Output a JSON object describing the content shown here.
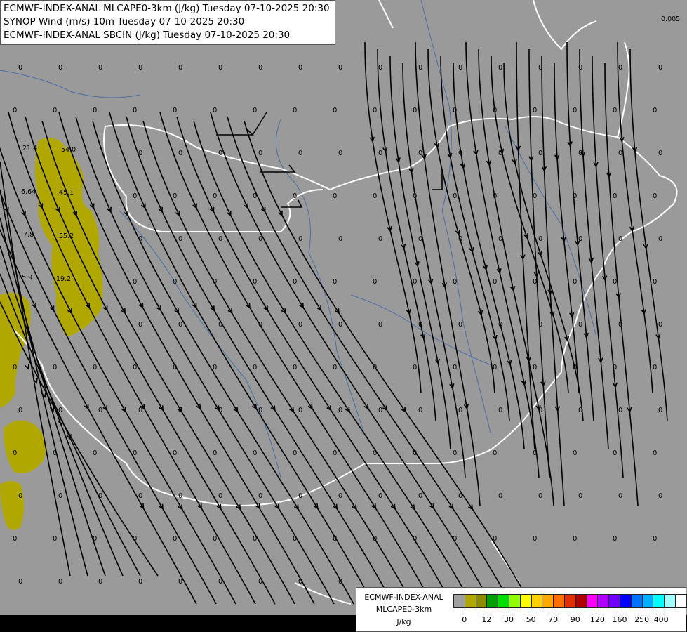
{
  "header": {
    "line1": "ECMWF-INDEX-ANAL MLCAPE0-3km (J/kg) Tuesday 07-10-2025 20:30",
    "line2": "SYNOP Wind (m/s) 10m Tuesday 07-10-2025 20:30",
    "line3": "ECMWF-INDEX-ANAL SBCIN (J/kg) Tuesday 07-10-2025 20:30"
  },
  "legend": {
    "title": "ECMWF-INDEX-ANAL",
    "param": "MLCAPE0-3km",
    "unit": "J/kg",
    "colors": [
      "#a0a0a0",
      "#b0a800",
      "#8c8c00",
      "#00a000",
      "#00e000",
      "#90ff00",
      "#ffff00",
      "#ffd000",
      "#ffa800",
      "#ff7000",
      "#e03000",
      "#b00000",
      "#ff00ff",
      "#b000ff",
      "#7000ff",
      "#0000ff",
      "#0070ff",
      "#00b0ff",
      "#00ffff",
      "#a0ffff",
      "#ffffff"
    ],
    "ticks": [
      "0",
      "12",
      "30",
      "50",
      "70",
      "90",
      "120",
      "160",
      "250",
      "400"
    ]
  },
  "map_labels": {
    "sbcin_small": "0.005",
    "sbcin_values": [
      "21.4",
      "54.0",
      "6.64",
      "45.1",
      "7.8",
      "55.2",
      "15.9",
      "19.2"
    ],
    "zero": "0"
  },
  "style": {
    "background": "#9a9a9a",
    "cape_fill": "#b0a800",
    "border_color": "#ffffff",
    "river_color": "#4a6fa5",
    "streamline_color": "#000000"
  }
}
